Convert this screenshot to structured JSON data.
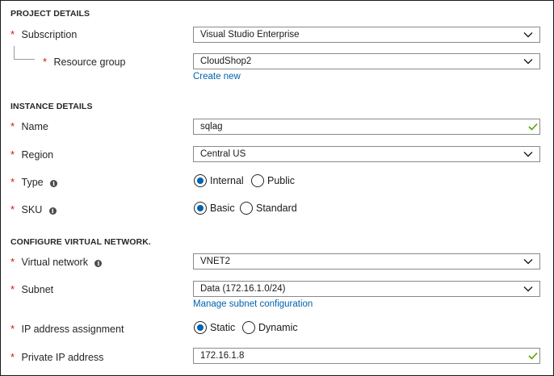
{
  "sections": {
    "project": "PROJECT DETAILS",
    "instance": "INSTANCE DETAILS",
    "network": "CONFIGURE VIRTUAL NETWORK."
  },
  "required_marker": "*",
  "info_glyph": "i",
  "subscription": {
    "label": "Subscription",
    "value": "Visual Studio Enterprise"
  },
  "resource_group": {
    "label": "Resource group",
    "value": "CloudShop2",
    "create_link": "Create new"
  },
  "name": {
    "label": "Name",
    "value": "sqlag"
  },
  "region": {
    "label": "Region",
    "value": "Central US"
  },
  "type": {
    "label": "Type",
    "options": [
      "Internal",
      "Public"
    ],
    "selected": "Internal"
  },
  "sku": {
    "label": "SKU",
    "options": [
      "Basic",
      "Standard"
    ],
    "selected": "Basic"
  },
  "virtual_network": {
    "label": "Virtual network",
    "value": "VNET2"
  },
  "subnet": {
    "label": "Subnet",
    "value": "Data (172.16.1.0/24)",
    "manage_link": "Manage subnet configuration"
  },
  "ip_assignment": {
    "label": "IP address assignment",
    "options": [
      "Static",
      "Dynamic"
    ],
    "selected": "Static"
  },
  "private_ip": {
    "label": "Private IP address",
    "value": "172.16.1.8"
  },
  "colors": {
    "accent": "#0062ad",
    "required": "#e00b1c",
    "valid": "#57a300",
    "border": "#8a8a8a"
  },
  "icons": {
    "dropdown": "chevron-down-icon",
    "valid": "checkmark-icon",
    "info": "info-icon"
  }
}
